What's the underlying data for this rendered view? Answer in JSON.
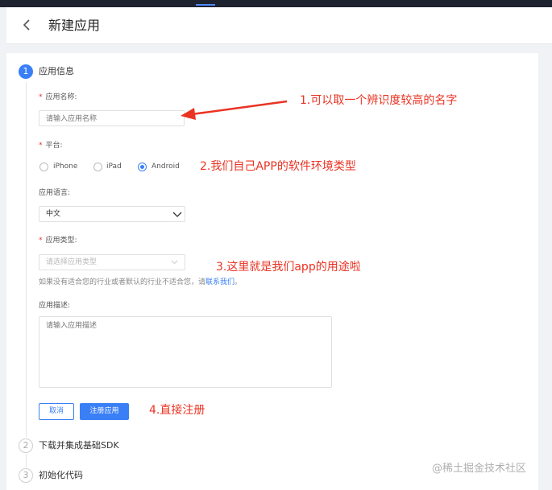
{
  "header": {
    "title": "新建应用"
  },
  "steps": [
    {
      "number": "1",
      "title": "应用信息"
    },
    {
      "number": "2",
      "title": "下载并集成基础SDK"
    },
    {
      "number": "3",
      "title": "初始化代码"
    }
  ],
  "form": {
    "app_name": {
      "label": "应用名称:",
      "placeholder": "请输入应用名称"
    },
    "platform": {
      "label": "平台:",
      "options": [
        "iPhone",
        "iPad",
        "Android"
      ],
      "selected": "Android"
    },
    "language": {
      "label": "应用语言:",
      "value": "中文"
    },
    "app_type": {
      "label": "应用类型:",
      "placeholder": "请选择应用类型"
    },
    "hint": {
      "text": "如果没有适合您的行业或者默认的行业不适合您，请",
      "link": "联系我们",
      "suffix": "。"
    },
    "description": {
      "label": "应用描述:",
      "placeholder": "请输入应用描述"
    },
    "buttons": {
      "cancel": "取消",
      "submit": "注册应用"
    }
  },
  "annotations": {
    "a1": "1.可以取一个辨识度较高的名字",
    "a2": "2.我们自己APP的软件环境类型",
    "a3": "3.这里就是我们app的用途啦",
    "a4": "4.直接注册"
  },
  "watermark": "@稀土掘金技术社区",
  "colors": {
    "accent": "#3a7ff6",
    "annotation": "#ea3323",
    "required": "#e5322b"
  }
}
